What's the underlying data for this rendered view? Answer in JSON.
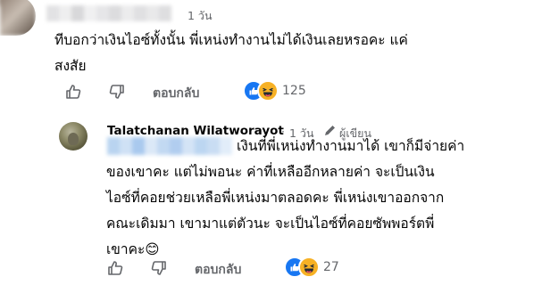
{
  "comment1": {
    "time": "1 วัน",
    "text_line1": "ทีบอกว่าเงินไอซ์ทั้งนั้น พี่เหน่งทำงานไม่ได้เงินเลยหรอคะ แค่",
    "text_line2": "สงสัย",
    "actions": {
      "like_icon": "thumbs-up-icon",
      "dislike_icon": "thumbs-down-icon",
      "reply": "ตอบกลับ"
    },
    "reactions": {
      "types": [
        "like",
        "haha"
      ],
      "count": "125"
    }
  },
  "comment2": {
    "author": "Talatchanan Wilatworayot",
    "dot": "·",
    "time": "1 วัน",
    "author_badge": "ผู้เขียน",
    "badge_icon": "pen-icon",
    "text_line1": "เงินที่พี่เหน่งทำงานมาได้ เขาก็มีจ่ายค่า",
    "text_line2": "ของเขาคะ แต่ไม่พอนะ ค่าที่เหลืออีกหลายค่า จะเป็นเงิน",
    "text_line3": "ไอซ์ที่คอยช่วยเหลือพี่เหน่งมาตลอดคะ พี่เหน่งเขาออกจาก",
    "text_line4": "คณะเดิมมา เขามาแต่ตัวนะ จะเป็นไอซ์ที่คอยซัพพอร์ตพี่",
    "text_line5": "เขาคะ",
    "emoji": "😊",
    "actions": {
      "like_icon": "thumbs-up-icon",
      "dislike_icon": "thumbs-down-icon",
      "reply": "ตอบกลับ"
    },
    "reactions": {
      "types": [
        "like",
        "haha"
      ],
      "count": "27"
    }
  }
}
